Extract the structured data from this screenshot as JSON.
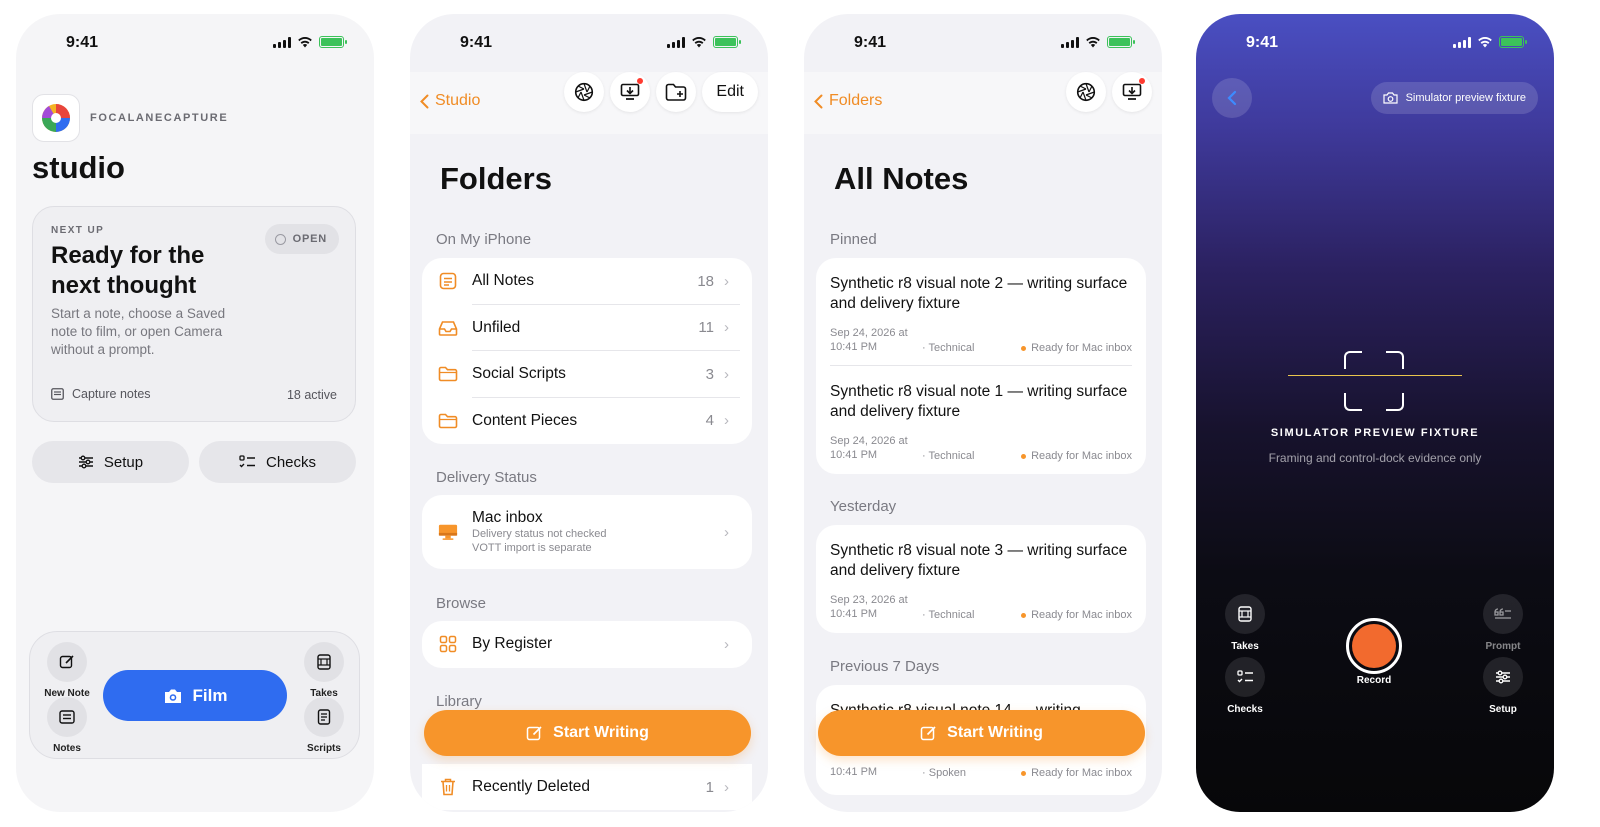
{
  "status": {
    "time": "9:41"
  },
  "studio": {
    "app_name": "FOCALANECAPTURE",
    "title": "studio",
    "next_up": {
      "eyebrow": "NEXT UP",
      "headline": "Ready for the next thought",
      "description": "Start a note, choose a Saved note to film, or open Camera without a prompt.",
      "open_label": "OPEN",
      "footer_left": "Capture notes",
      "footer_right": "18 active"
    },
    "setup_label": "Setup",
    "checks_label": "Checks",
    "dock": {
      "new_note": "New Note",
      "notes": "Notes",
      "film": "Film",
      "takes": "Takes",
      "scripts": "Scripts"
    }
  },
  "folders": {
    "back_label": "Studio",
    "edit_label": "Edit",
    "title": "Folders",
    "sections": {
      "on_iphone": "On My iPhone",
      "delivery": "Delivery Status",
      "browse": "Browse",
      "library": "Library"
    },
    "items": [
      {
        "label": "All Notes",
        "count": "18",
        "icon": "notes-icon"
      },
      {
        "label": "Unfiled",
        "count": "11",
        "icon": "tray-icon"
      },
      {
        "label": "Social Scripts",
        "count": "3",
        "icon": "folder-icon"
      },
      {
        "label": "Content Pieces",
        "count": "4",
        "icon": "folder-icon"
      }
    ],
    "mac_inbox": {
      "label": "Mac inbox",
      "line1": "Delivery status not checked",
      "line2": "VOTT import is separate"
    },
    "by_register": "By Register",
    "recently_deleted": {
      "label": "Recently Deleted",
      "count": "1"
    },
    "cta": "Start Writing"
  },
  "all_notes": {
    "back_label": "Folders",
    "title": "All Notes",
    "sections": {
      "pinned": "Pinned",
      "yesterday": "Yesterday",
      "previous": "Previous 7 Days"
    },
    "pinned": [
      {
        "title": "Synthetic r8 visual note 2 — writing surface and delivery fixture",
        "date": "Sep 24, 2026 at 10:41 PM",
        "category": "Technical",
        "status": "Ready for Mac inbox"
      },
      {
        "title": "Synthetic r8 visual note 1 — writing surface and delivery fixture",
        "date": "Sep 24, 2026 at 10:41 PM",
        "category": "Technical",
        "status": "Ready for Mac inbox"
      }
    ],
    "yesterday": [
      {
        "title": "Synthetic r8 visual note 3 — writing surface and delivery fixture",
        "date": "Sep 23, 2026 at 10:41 PM",
        "category": "Technical",
        "status": "Ready for Mac inbox"
      }
    ],
    "previous": [
      {
        "title": "Synthetic r8 visual note 14 — writing",
        "date": "10:41 PM",
        "category": "Spoken",
        "status": "Ready for Mac inbox"
      }
    ],
    "cta": "Start Writing"
  },
  "camera": {
    "chip_label": "Simulator preview fixture",
    "title": "SIMULATOR PREVIEW FIXTURE",
    "subtitle": "Framing and control-dock evidence only",
    "takes": "Takes",
    "prompt": "Prompt",
    "record": "Record",
    "checks": "Checks",
    "setup": "Setup"
  },
  "colors": {
    "accent_orange": "#f7952b",
    "film_blue": "#2f6cf0",
    "record_red": "#f26a2e",
    "battery_green": "#3cc25a"
  }
}
